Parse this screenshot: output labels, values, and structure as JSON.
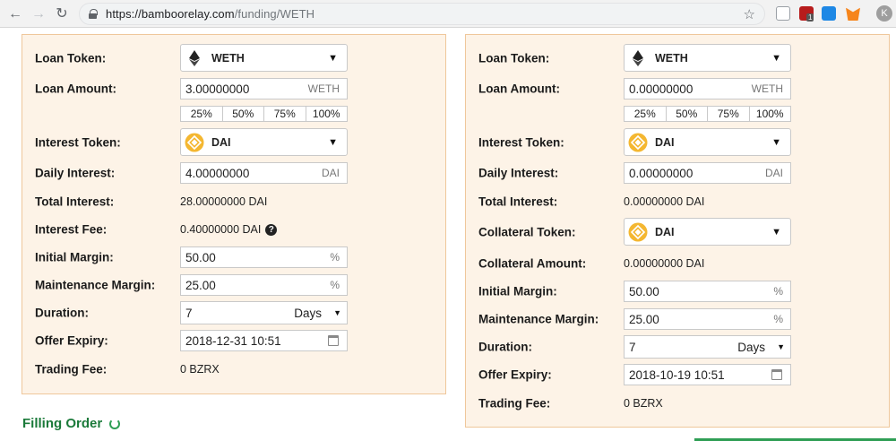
{
  "browser": {
    "url_host": "https://bamboorelay.com",
    "url_path": "/funding/WETH",
    "profile_initial": "K",
    "extension_badge": "1"
  },
  "left_panel": {
    "loan_token": {
      "label": "Loan Token:",
      "value": "WETH"
    },
    "loan_amount": {
      "label": "Loan Amount:",
      "value": "3.00000000",
      "unit": "WETH"
    },
    "percent_buttons": [
      "25%",
      "50%",
      "75%",
      "100%"
    ],
    "interest_token": {
      "label": "Interest Token:",
      "value": "DAI"
    },
    "daily_interest": {
      "label": "Daily Interest:",
      "value": "4.00000000",
      "unit": "DAI"
    },
    "total_interest": {
      "label": "Total Interest:",
      "value": "28.00000000 DAI"
    },
    "interest_fee": {
      "label": "Interest Fee:",
      "value": "0.40000000 DAI",
      "help": "?"
    },
    "initial_margin": {
      "label": "Initial Margin:",
      "value": "50.00",
      "unit": "%"
    },
    "maintenance_margin": {
      "label": "Maintenance Margin:",
      "value": "25.00",
      "unit": "%"
    },
    "duration": {
      "label": "Duration:",
      "value": "7",
      "unit": "Days"
    },
    "offer_expiry": {
      "label": "Offer Expiry:",
      "value": "2018-12-31 10:51"
    },
    "trading_fee": {
      "label": "Trading Fee:",
      "value": "0 BZRX"
    }
  },
  "right_panel": {
    "loan_token": {
      "label": "Loan Token:",
      "value": "WETH"
    },
    "loan_amount": {
      "label": "Loan Amount:",
      "value": "0.00000000",
      "unit": "WETH"
    },
    "percent_buttons": [
      "25%",
      "50%",
      "75%",
      "100%"
    ],
    "interest_token": {
      "label": "Interest Token:",
      "value": "DAI"
    },
    "daily_interest": {
      "label": "Daily Interest:",
      "value": "0.00000000",
      "unit": "DAI"
    },
    "total_interest": {
      "label": "Total Interest:",
      "value": "0.00000000 DAI"
    },
    "collateral_token": {
      "label": "Collateral Token:",
      "value": "DAI"
    },
    "collateral_amount": {
      "label": "Collateral Amount:",
      "value": "0.00000000 DAI"
    },
    "initial_margin": {
      "label": "Initial Margin:",
      "value": "50.00",
      "unit": "%"
    },
    "maintenance_margin": {
      "label": "Maintenance Margin:",
      "value": "25.00",
      "unit": "%"
    },
    "duration": {
      "label": "Duration:",
      "value": "7",
      "unit": "Days"
    },
    "offer_expiry": {
      "label": "Offer Expiry:",
      "value": "2018-10-19 10:51"
    },
    "trading_fee": {
      "label": "Trading Fee:",
      "value": "0 BZRX"
    }
  },
  "status": {
    "filling_order": "Filling Order"
  },
  "colors": {
    "panel_bg": "#fdf3e7",
    "panel_border": "#efc79b",
    "status_green": "#1b7a3a",
    "dai_gold": "#f4b731"
  }
}
